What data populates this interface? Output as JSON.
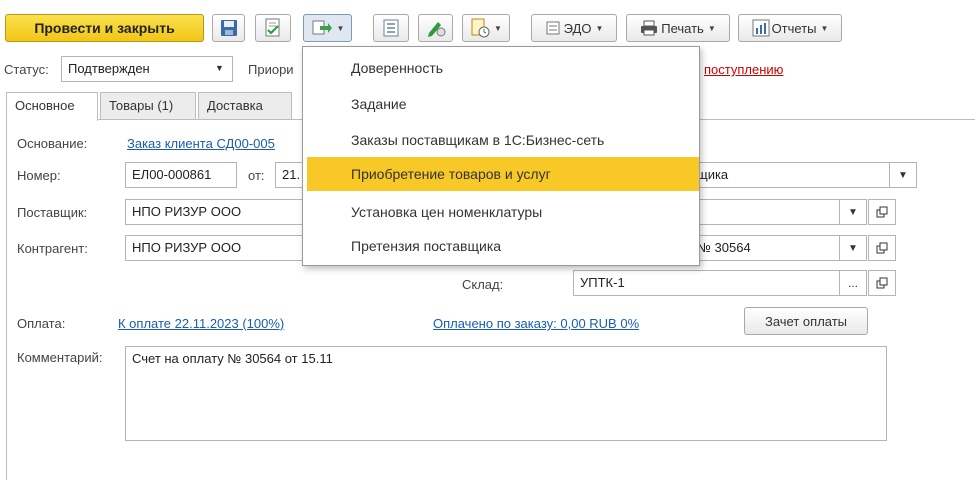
{
  "toolbar": {
    "post_close_label": "Провести и закрыть",
    "edo_label": "ЭДО",
    "print_label": "Печать",
    "reports_label": "Отчеты"
  },
  "status": {
    "label": "Статус:",
    "value": "Подтвержден",
    "priority_label_visible": "Приори",
    "link_visible": "поступлению"
  },
  "tabs": [
    {
      "label": "Основное",
      "active": true
    },
    {
      "label": "Товары (1)",
      "active": false
    },
    {
      "label": "Доставка",
      "active": false
    }
  ],
  "form": {
    "basis_label": "Основание:",
    "basis_link": "Заказ клиента СД00-005",
    "number_label": "Номер:",
    "number_value": "ЕЛ00-000861",
    "date_label": "от:",
    "date_value_visible": "21.",
    "org_value_visible": "щика",
    "supplier_label": "Поставщик:",
    "supplier_value": "НПО РИЗУР ООО",
    "contractor_label": "Контрагент:",
    "contractor_value": "НПО РИЗУР ООО",
    "contract_value_visible": "№ 30564",
    "warehouse_label": "Склад:",
    "warehouse_value": "УПТК-1",
    "payment_label": "Оплата:",
    "payment_link": "К оплате 22.11.2023 (100%)",
    "paid_link": "Оплачено по заказу: 0,00 RUB 0%",
    "offset_button": "Зачет оплаты",
    "comment_label": "Комментарий:",
    "comment_value": "Счет на оплату № 30564 от 15.11",
    "ellipsis": "..."
  },
  "dropdown_menu": {
    "items": [
      {
        "label": "Доверенность",
        "highlighted": false
      },
      {
        "label": "Задание",
        "highlighted": false
      },
      {
        "label": "Заказы поставщикам в 1С:Бизнес-сеть",
        "highlighted": false
      },
      {
        "label": "Приобретение товаров и услуг",
        "highlighted": true
      },
      {
        "label": "Установка цен номенклатуры",
        "highlighted": false
      },
      {
        "label": "Претензия поставщика",
        "highlighted": false
      }
    ]
  },
  "colors": {
    "primary_button": "#f2c617",
    "menu_highlight": "#f8c826",
    "link": "#1a5cb1",
    "link_alert": "#cc0000"
  },
  "icons": {
    "save": "floppy-disk-icon",
    "post": "document-check-icon",
    "create_based_on": "create-based-on-icon",
    "list": "list-icon",
    "sign": "pen-sign-icon",
    "tasks": "document-clock-icon",
    "print": "printer-icon",
    "reports": "reports-icon",
    "open": "open-in-window-icon"
  }
}
